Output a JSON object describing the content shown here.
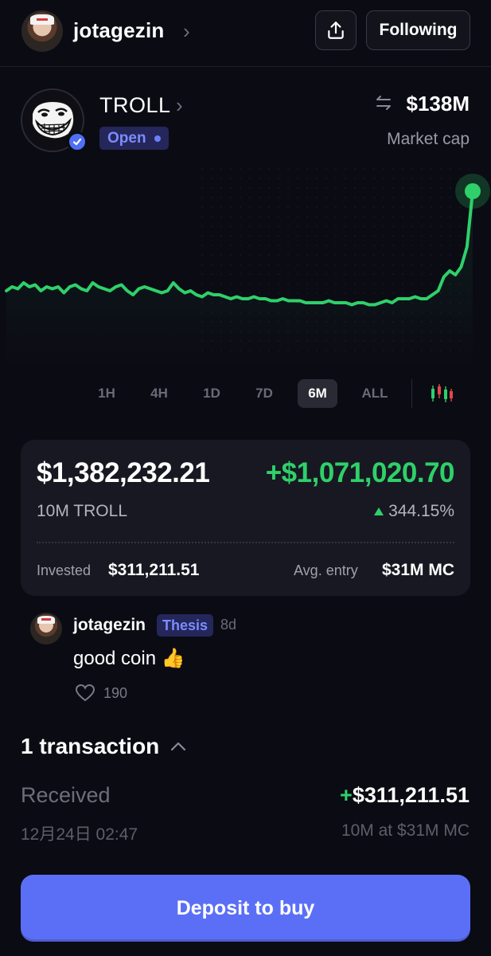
{
  "header": {
    "username": "jotagezin",
    "follow_label": "Following"
  },
  "token": {
    "name": "TROLL",
    "status": "Open",
    "market_cap": "$138M",
    "market_cap_label": "Market cap"
  },
  "chart_data": {
    "type": "line",
    "title": "",
    "xlabel": "",
    "ylabel": "",
    "grid": false,
    "series": [
      {
        "color": "#2fd06a",
        "values": [
          0.62,
          0.6,
          0.61,
          0.58,
          0.6,
          0.59,
          0.62,
          0.6,
          0.61,
          0.6,
          0.63,
          0.6,
          0.59,
          0.61,
          0.62,
          0.58,
          0.6,
          0.61,
          0.62,
          0.6,
          0.59,
          0.62,
          0.64,
          0.61,
          0.6,
          0.61,
          0.62,
          0.63,
          0.62,
          0.58,
          0.61,
          0.63,
          0.62,
          0.64,
          0.65,
          0.63,
          0.64,
          0.64,
          0.65,
          0.66,
          0.65,
          0.66,
          0.66,
          0.65,
          0.66,
          0.66,
          0.67,
          0.67,
          0.66,
          0.67,
          0.67,
          0.67,
          0.68,
          0.68,
          0.68,
          0.68,
          0.67,
          0.68,
          0.68,
          0.68,
          0.69,
          0.68,
          0.68,
          0.69,
          0.69,
          0.68,
          0.67,
          0.68,
          0.66,
          0.66,
          0.66,
          0.65,
          0.66,
          0.66,
          0.64,
          0.62,
          0.55,
          0.52,
          0.54,
          0.5,
          0.4,
          0.12
        ]
      }
    ]
  },
  "range_tabs": [
    "1H",
    "4H",
    "1D",
    "7D",
    "6M",
    "ALL"
  ],
  "range_active": "6M",
  "position": {
    "value": "$1,382,232.21",
    "pnl": "+$1,071,020.70",
    "amount": "10M TROLL",
    "pnl_pct": "344.15%",
    "invested_label": "Invested",
    "invested_value": "$311,211.51",
    "avg_entry_label": "Avg. entry",
    "avg_entry_value": "$31M MC"
  },
  "comment": {
    "user": "jotagezin",
    "badge": "Thesis",
    "time": "8d",
    "text": "good coin 👍",
    "likes": "190"
  },
  "transactions": {
    "header": "1 transaction",
    "items": [
      {
        "type": "Received",
        "sign": "+",
        "amount": "$311,211.51",
        "date": "12月24日 02:47",
        "detail": "10M at $31M MC"
      }
    ]
  },
  "cta": {
    "deposit_label": "Deposit to buy"
  },
  "colors": {
    "background": "#0b0b14",
    "accent": "#5b6ff6",
    "positive": "#2fd06a",
    "badge_text": "#7b8cff"
  }
}
